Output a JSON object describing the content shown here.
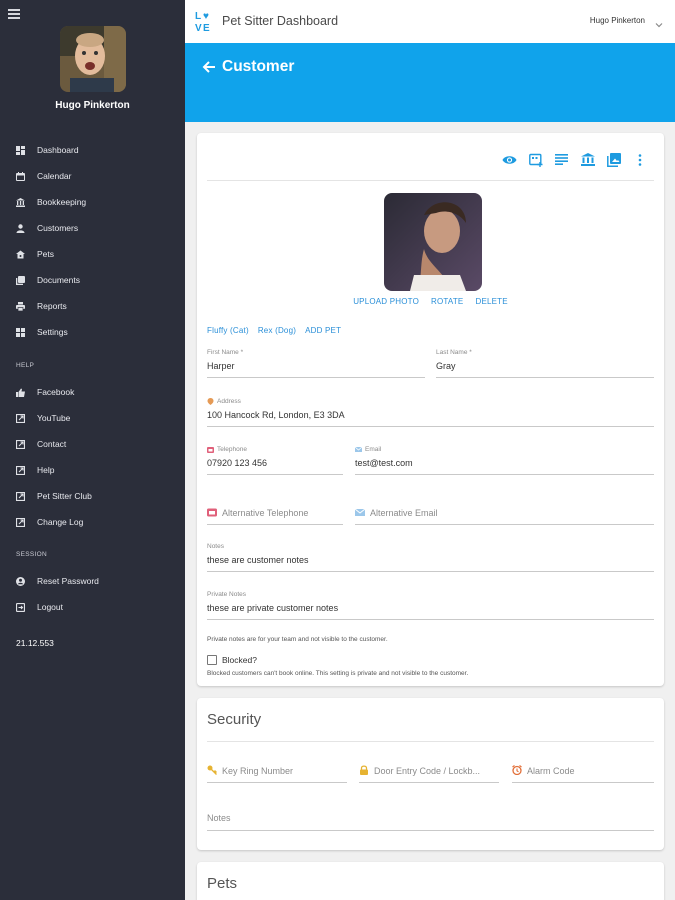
{
  "sidebar": {
    "user_name": "Hugo Pinkerton",
    "items": [
      {
        "label": "Dashboard",
        "icon": "dashboard-icon"
      },
      {
        "label": "Calendar",
        "icon": "calendar-icon"
      },
      {
        "label": "Bookkeeping",
        "icon": "bank-icon"
      },
      {
        "label": "Customers",
        "icon": "person-icon"
      },
      {
        "label": "Pets",
        "icon": "paw-icon"
      },
      {
        "label": "Documents",
        "icon": "documents-icon"
      },
      {
        "label": "Reports",
        "icon": "printer-icon"
      },
      {
        "label": "Settings",
        "icon": "grid-icon"
      }
    ],
    "help_heading": "HELP",
    "help_items": [
      {
        "label": "Facebook",
        "icon": "thumbs-up-icon"
      },
      {
        "label": "YouTube",
        "icon": "external-link-icon"
      },
      {
        "label": "Contact",
        "icon": "external-link-icon"
      },
      {
        "label": "Help",
        "icon": "external-link-icon"
      },
      {
        "label": "Pet Sitter Club",
        "icon": "external-link-icon"
      },
      {
        "label": "Change Log",
        "icon": "external-link-icon"
      }
    ],
    "session_heading": "SESSION",
    "session_items": [
      {
        "label": "Reset Password",
        "icon": "account-circle-icon"
      },
      {
        "label": "Logout",
        "icon": "logout-icon"
      }
    ],
    "version": "21.12.553"
  },
  "topbar": {
    "title": "Pet Sitter Dashboard",
    "logo_text": "LOVE",
    "user_menu": "Hugo Pinkerton"
  },
  "header": {
    "title": "Customer"
  },
  "colors": {
    "sidebar_bg": "#2b2e3a",
    "header_blue": "#10a3eb",
    "link_blue": "#2a8fd8"
  },
  "customer": {
    "toolbar_icons": [
      "eye-icon",
      "calendar-add-icon",
      "notes-icon",
      "bank-icon",
      "photo-library-icon",
      "more-vert-icon"
    ],
    "photo_actions": {
      "upload": "UPLOAD PHOTO",
      "rotate": "ROTATE",
      "delete": "DELETE"
    },
    "pets": [
      "Fluffy (Cat)",
      "Rex (Dog)"
    ],
    "add_pet": "ADD PET",
    "first_name": {
      "label": "First Name *",
      "value": "Harper"
    },
    "last_name": {
      "label": "Last Name *",
      "value": "Gray"
    },
    "address": {
      "label": "Address",
      "value": "100 Hancock Rd, London, E3 3DA"
    },
    "telephone": {
      "label": "Telephone",
      "value": "07920 123 456"
    },
    "email": {
      "label": "Email",
      "value": "test@test.com"
    },
    "alt_telephone": {
      "placeholder": "Alternative Telephone"
    },
    "alt_email": {
      "placeholder": "Alternative Email"
    },
    "notes": {
      "label": "Notes",
      "value": "these are customer notes"
    },
    "private_notes": {
      "label": "Private Notes",
      "value": "these are private customer notes"
    },
    "private_notes_help": "Private notes are for your team and not visible to the customer.",
    "blocked": {
      "label": "Blocked?",
      "checked": false
    },
    "blocked_help": "Blocked customers can't book online. This setting is private and not visible to the customer."
  },
  "security": {
    "title": "Security",
    "key_ring": {
      "placeholder": "Key Ring Number"
    },
    "door_code": {
      "placeholder": "Door Entry Code / Lockb..."
    },
    "alarm_code": {
      "placeholder": "Alarm Code"
    },
    "notes": {
      "placeholder": "Notes"
    }
  },
  "pets_section": {
    "title": "Pets"
  }
}
